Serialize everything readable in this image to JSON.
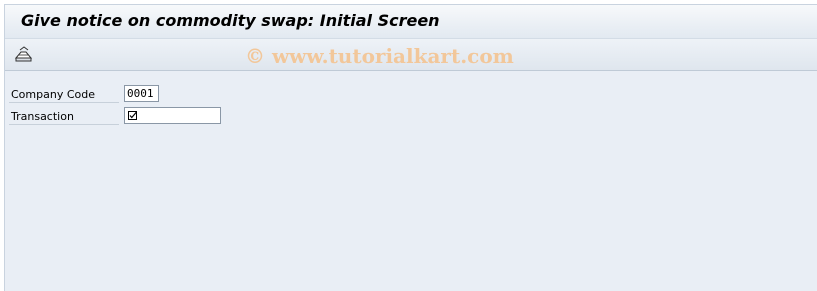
{
  "window": {
    "title": "Give notice on commodity swap: Initial Screen"
  },
  "toolbar": {
    "execute_icon": "execute-icon",
    "watermark": "© www.tutorialkart.com"
  },
  "form": {
    "company_code": {
      "label": "Company Code",
      "value": "0001"
    },
    "transaction": {
      "label": "Transaction",
      "value": "",
      "icon": "checkbox-icon"
    }
  }
}
